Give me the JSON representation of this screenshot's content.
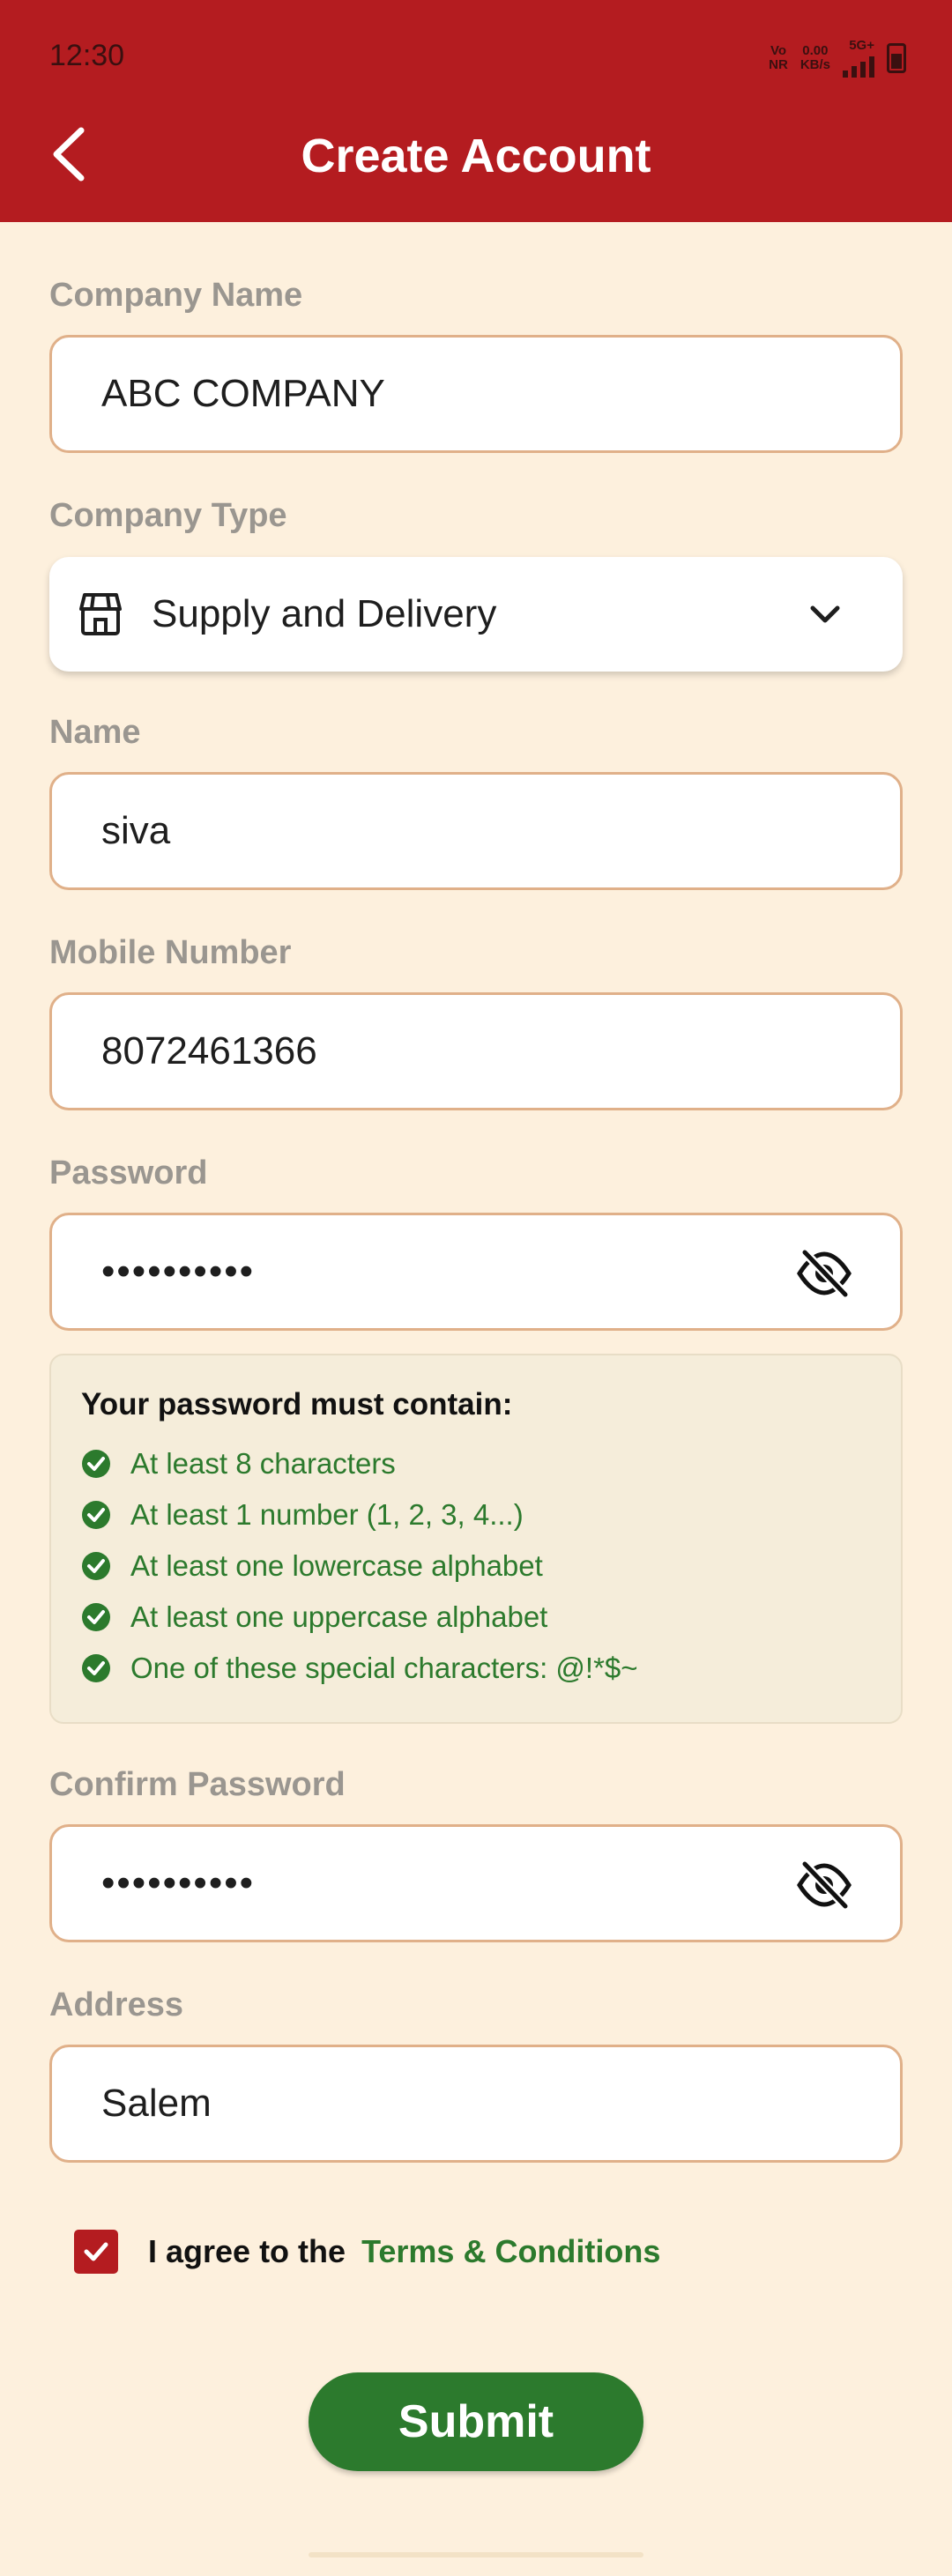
{
  "status_bar": {
    "time": "12:30",
    "volte_top": "Vo",
    "volte_bottom": "NR",
    "speed_top": "0.00",
    "speed_bottom": "KB/s",
    "network": "5G+"
  },
  "header": {
    "title": "Create Account",
    "back_icon": "chevron-left-icon"
  },
  "form": {
    "company_name": {
      "label": "Company Name",
      "value": "ABC COMPANY"
    },
    "company_type": {
      "label": "Company Type",
      "value": "Supply and Delivery",
      "icon": "store-icon"
    },
    "name": {
      "label": "Name",
      "value": "siva"
    },
    "mobile": {
      "label": "Mobile Number",
      "value": "8072461366"
    },
    "password": {
      "label": "Password",
      "value": "••••••••••"
    },
    "password_rules": {
      "title": "Your password must contain:",
      "items": [
        "At least 8 characters",
        "At least 1 number (1, 2, 3, 4...)",
        "At least one lowercase alphabet",
        "At least one uppercase alphabet",
        "One of these special characters: @!*$~"
      ]
    },
    "confirm_password": {
      "label": "Confirm Password",
      "value": "••••••••••"
    },
    "address": {
      "label": "Address",
      "value": "Salem"
    },
    "agree": {
      "text": "I agree to the",
      "link": "Terms & Conditions",
      "checked": true
    },
    "submit": "Submit"
  },
  "colors": {
    "primary_red": "#B41C20",
    "success_green": "#2C7A2D",
    "background": "#FDF0DD",
    "field_border": "#E0B089"
  }
}
